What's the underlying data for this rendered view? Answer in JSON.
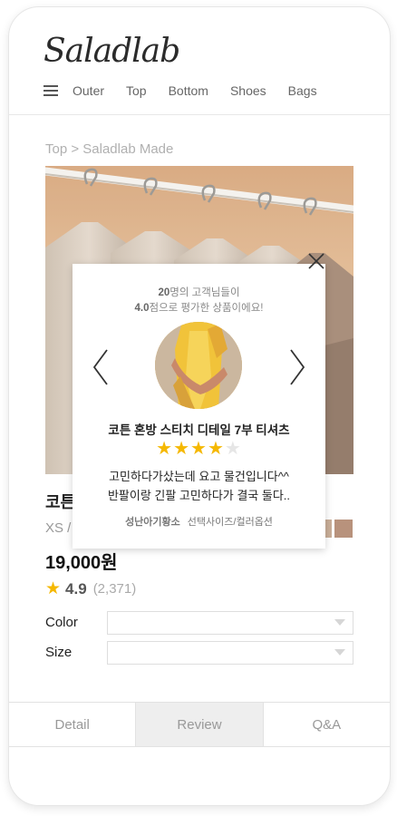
{
  "brand": {
    "logo": "Saladlab"
  },
  "nav": {
    "items": [
      "Outer",
      "Top",
      "Bottom",
      "Shoes",
      "Bags"
    ]
  },
  "breadcrumb": "Top > Saladlab Made",
  "product": {
    "title_visible": "코튼",
    "options_visible": "XS /",
    "price": "19,000원",
    "rating": "4.9",
    "rating_count": "(2,371)",
    "swatch_colors": [
      "#c9ae98",
      "#b8927c"
    ]
  },
  "options": {
    "color_label": "Color",
    "size_label": "Size",
    "color_value": "",
    "size_value": ""
  },
  "tabs": [
    {
      "label": "Detail",
      "active": false
    },
    {
      "label": "Review",
      "active": true
    },
    {
      "label": "Q&A",
      "active": false
    }
  ],
  "popup": {
    "count": "20",
    "line1_suffix": "명의 고객님들이",
    "score": "4.0",
    "line2_suffix": "점으로 평가한 상품이에요!",
    "review": {
      "title": "코튼 혼방 스티치 디테일 7부 티셔츠",
      "stars": 4,
      "max_stars": 5,
      "text_line1": "고민하다가샀는데 요고 물건입니다^^",
      "text_line2": "반팔이랑 긴팔 고민하다가 결국 둘다..",
      "author": "성난아기황소",
      "option": "선택사이즈/컬러옵션"
    }
  },
  "icons": {
    "menu": "hamburger-icon",
    "close": "close-icon",
    "prev": "chevron-left-icon",
    "next": "chevron-right-icon",
    "star": "star-icon"
  },
  "colors": {
    "star": "#f5b800",
    "active_tab_bg": "#eeeeee"
  }
}
